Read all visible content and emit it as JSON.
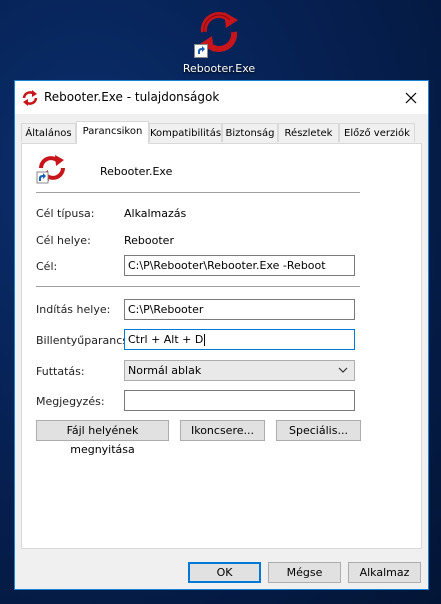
{
  "desktop": {
    "icon_label": "Rebooter.Exe",
    "icon": "rebooter-arrows-icon"
  },
  "window": {
    "title": "Rebooter.Exe - tulajdonságok",
    "close_icon": "close-icon",
    "tabs": [
      {
        "label": "Általános"
      },
      {
        "label": "Parancsikon",
        "active": true
      },
      {
        "label": "Kompatibilitás"
      },
      {
        "label": "Biztonság"
      },
      {
        "label": "Részletek"
      },
      {
        "label": "Előző verziók"
      }
    ]
  },
  "shortcut": {
    "name": "Rebooter.Exe",
    "target_type_label": "Cél típusa:",
    "target_type_value": "Alkalmazás",
    "target_location_label": "Cél helye:",
    "target_location_value": "Rebooter",
    "target_label": "Cél:",
    "target_value": "C:\\P\\Rebooter\\Rebooter.Exe -Reboot",
    "start_in_label": "Indítás helye:",
    "start_in_value": "C:\\P\\Rebooter",
    "hotkey_label": "Billentyűparancs:",
    "hotkey_value": "Ctrl + Alt + D",
    "run_label": "Futtatás:",
    "run_value": "Normál ablak",
    "comment_label": "Megjegyzés:",
    "comment_value": "",
    "open_location_button": "Fájl helyének megnyitása",
    "change_icon_button": "Ikoncsere...",
    "advanced_button": "Speciális..."
  },
  "footer": {
    "ok": "OK",
    "cancel": "Mégse",
    "apply": "Alkalmaz"
  },
  "colors": {
    "accent": "#0078d7",
    "icon_red": "#c8151b",
    "desktop_bg": "#062154"
  }
}
